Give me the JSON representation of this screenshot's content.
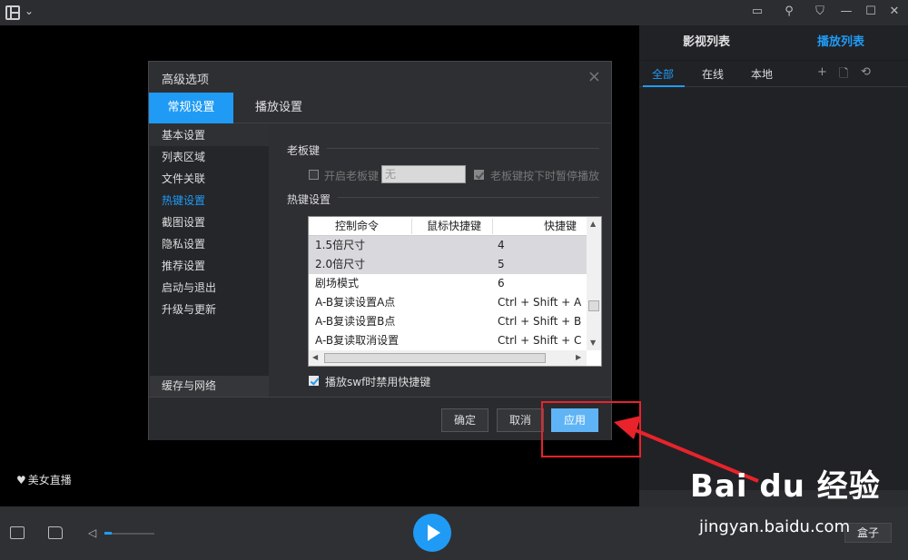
{
  "topbar": {
    "chevron": "⌄",
    "icons": [
      "message-icon",
      "pin-icon",
      "shirt-icon",
      "minimize-icon",
      "maximize-icon",
      "close-icon"
    ]
  },
  "right_panel": {
    "tabs": [
      {
        "label": "影视列表",
        "active": false
      },
      {
        "label": "播放列表",
        "active": true
      }
    ],
    "subtabs": [
      {
        "label": "全部",
        "active": true
      },
      {
        "label": "在线",
        "active": false
      },
      {
        "label": "本地",
        "active": false
      }
    ]
  },
  "player": {
    "live_label": "美女直播"
  },
  "bottombar": {
    "box_label": "盒子",
    "volume_level": 0.15
  },
  "dialog": {
    "title": "高级选项",
    "tabs": [
      {
        "label": "常规设置",
        "active": true
      },
      {
        "label": "播放设置",
        "active": false
      }
    ],
    "nav": [
      {
        "label": "基本设置",
        "selected": true,
        "active": false
      },
      {
        "label": "列表区域",
        "selected": false,
        "active": false
      },
      {
        "label": "文件关联",
        "selected": false,
        "active": false
      },
      {
        "label": "热键设置",
        "selected": false,
        "active": true
      },
      {
        "label": "截图设置",
        "selected": false,
        "active": false
      },
      {
        "label": "隐私设置",
        "selected": false,
        "active": false
      },
      {
        "label": "推荐设置",
        "selected": false,
        "active": false
      },
      {
        "label": "启动与退出",
        "selected": false,
        "active": false
      },
      {
        "label": "升级与更新",
        "selected": false,
        "active": false
      }
    ],
    "nav_bottom": "缓存与网络",
    "boss_key": {
      "section_label": "老板键",
      "enable_label": "开启老板键",
      "enable_checked": false,
      "input_value": "无",
      "pause_label": "老板键按下时暂停播放",
      "pause_checked": true
    },
    "hotkey": {
      "section_label": "热键设置",
      "columns": [
        "控制命令",
        "鼠标快捷键",
        "快捷键"
      ],
      "rows": [
        {
          "command": "1.5倍尺寸",
          "mouse": "",
          "key": "4",
          "highlight": true
        },
        {
          "command": "2.0倍尺寸",
          "mouse": "",
          "key": "5",
          "highlight": true
        },
        {
          "command": "剧场模式",
          "mouse": "",
          "key": "6",
          "highlight": false
        },
        {
          "command": "A-B复读设置A点",
          "mouse": "",
          "key": "Ctrl + Shift + A",
          "highlight": false
        },
        {
          "command": "A-B复读设置B点",
          "mouse": "",
          "key": "Ctrl + Shift + B",
          "highlight": false
        },
        {
          "command": "A-B复读取消设置",
          "mouse": "",
          "key": "Ctrl + Shift + C",
          "highlight": false
        }
      ],
      "disable_swf_label": "播放swf时禁用快捷键",
      "disable_swf_checked": true
    },
    "buttons": {
      "ok": "确定",
      "cancel": "取消",
      "apply": "应用"
    }
  },
  "watermark": {
    "brand": "Bai du 经验",
    "url": "jingyan.baidu.com"
  },
  "colors": {
    "accent": "#1f9bf5",
    "annotation": "#e8232b"
  }
}
